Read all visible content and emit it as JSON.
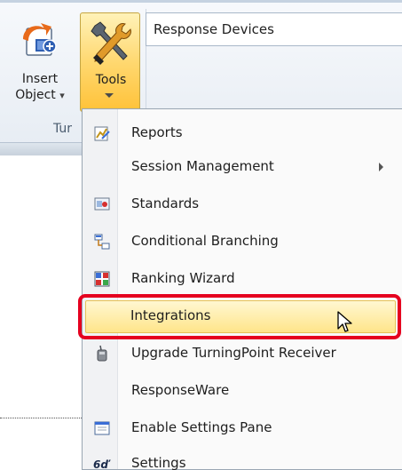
{
  "ribbon": {
    "insert_object_label_line1": "Insert",
    "insert_object_label_line2": "Object",
    "insert_object_dropdown": "▾",
    "tools_label": "Tools",
    "group_label": "Tur",
    "response_devices_label": "Response Devices"
  },
  "menu": {
    "items": [
      {
        "label": "Reports",
        "icon": "reports-icon"
      },
      {
        "label": "Session Management",
        "icon": "",
        "has_submenu": true
      },
      {
        "label": "Standards",
        "icon": "standards-icon"
      },
      {
        "label": "Conditional Branching",
        "icon": "conditional-branching-icon"
      },
      {
        "label": "Ranking Wizard",
        "icon": "ranking-wizard-icon"
      },
      {
        "label": "Integrations",
        "icon": "",
        "highlighted": true
      },
      {
        "label": "Upgrade TurningPoint Receiver",
        "icon": "receiver-icon"
      },
      {
        "label": "ResponseWare",
        "icon": ""
      },
      {
        "label": "Enable Settings Pane",
        "icon": "settings-pane-icon"
      },
      {
        "label": "Settings",
        "icon": "settings-icon"
      }
    ]
  },
  "colors": {
    "highlight_fill": "#ffe58a",
    "annotation_red": "#e5001f",
    "tools_button_fill": "#ffd870"
  }
}
